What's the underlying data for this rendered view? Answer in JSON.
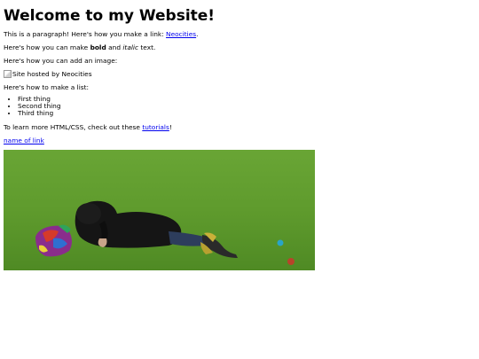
{
  "heading": "Welcome to my Website!",
  "p1": {
    "text": "This is a paragraph! Here's how you make a link: ",
    "link": "Neocities",
    "after": "."
  },
  "p2": {
    "prefix": "Here's how you can make ",
    "bold": "bold",
    "middle": " and ",
    "italic": "italic",
    "suffix": " text."
  },
  "p3": "Here's how you can add an image:",
  "image_alt": "Site hosted by Neocities",
  "p4": "Here's how to make a list:",
  "list": [
    "First thing",
    "Second thing",
    "Third thing"
  ],
  "p5": {
    "text": "To learn more HTML/CSS, check out these ",
    "link": "tutorials",
    "after": "!"
  },
  "link_name": "name of link",
  "colors": {
    "link": "#0000ee",
    "backdrop": "#5f9b2e"
  }
}
